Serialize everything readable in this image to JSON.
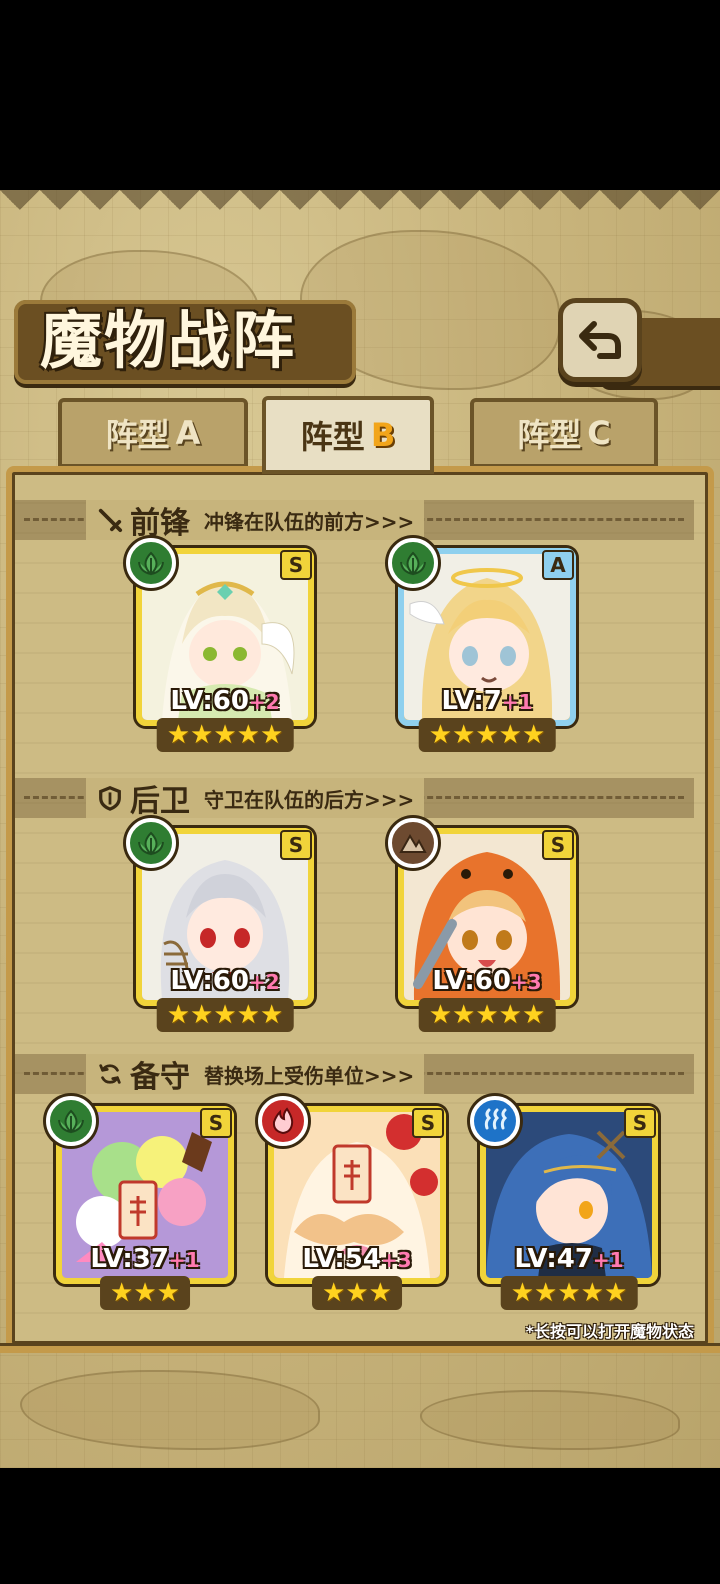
{
  "screen": {
    "title": "魔物战阵",
    "back_icon": "return-arrow-icon",
    "hint": "*长按可以打开魔物状态"
  },
  "tabs": [
    {
      "prefix": "阵型",
      "letter": "A",
      "active": false
    },
    {
      "prefix": "阵型",
      "letter": "B",
      "active": true
    },
    {
      "prefix": "阵型",
      "letter": "C",
      "active": false
    }
  ],
  "sections": {
    "front": {
      "name": "前锋",
      "desc": "冲锋在队伍的前方>>>",
      "icon": "sword-icon"
    },
    "rear": {
      "name": "后卫",
      "desc": "守卫在队伍的后方>>>",
      "icon": "shield-icon"
    },
    "reserve": {
      "name": "备守",
      "desc": "替换场上受伤单位>>>",
      "icon": "swap-icon"
    }
  },
  "units": {
    "front": [
      {
        "element": "leaf",
        "rank": "S",
        "lv": "LV:60",
        "plus": "+2",
        "stars": 5
      },
      {
        "element": "leaf",
        "rank": "A",
        "lv": "LV:7",
        "plus": "+1",
        "stars": 5
      }
    ],
    "rear": [
      {
        "element": "leaf",
        "rank": "S",
        "lv": "LV:60",
        "plus": "+2",
        "stars": 5
      },
      {
        "element": "rock",
        "rank": "S",
        "lv": "LV:60",
        "plus": "+3",
        "stars": 5
      }
    ],
    "reserve": [
      {
        "element": "leaf",
        "rank": "S",
        "lv": "LV:37",
        "plus": "+1",
        "stars": 3
      },
      {
        "element": "fire",
        "rank": "S",
        "lv": "LV:54",
        "plus": "+3",
        "stars": 3
      },
      {
        "element": "water",
        "rank": "S",
        "lv": "LV:47",
        "plus": "+1",
        "stars": 5
      }
    ]
  },
  "colors": {
    "rank_s": "#f1d43a",
    "rank_a": "#8fd0ee",
    "star": "#ffd21f",
    "level_plus": "#ff7ab0"
  }
}
